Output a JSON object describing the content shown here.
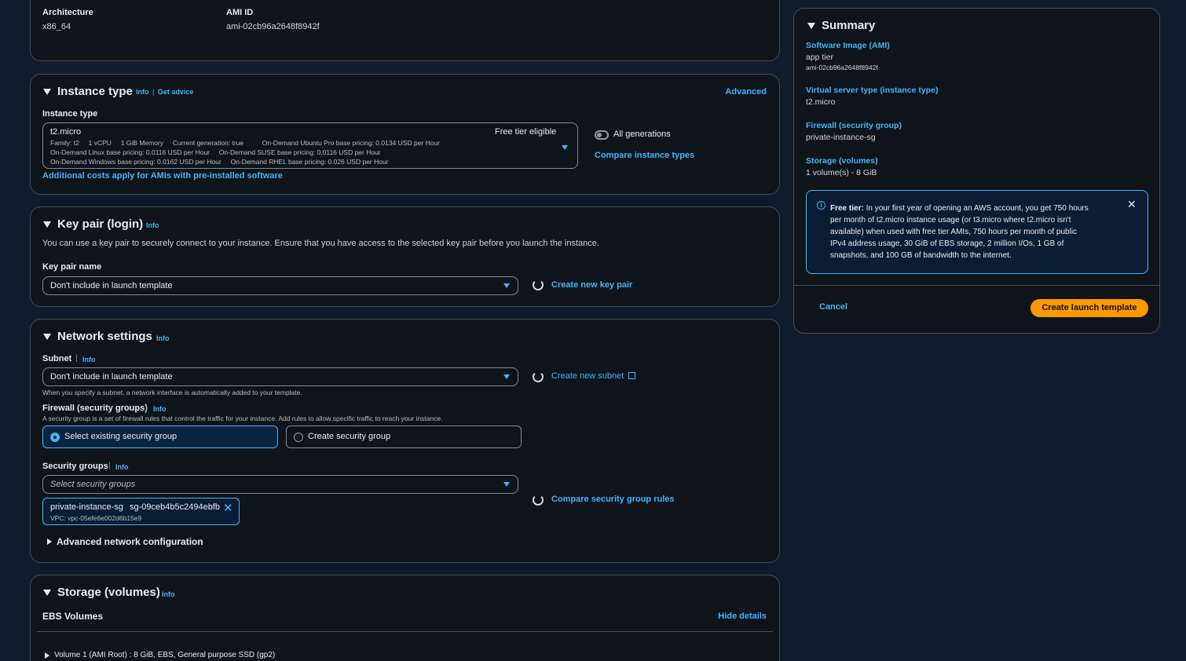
{
  "ami_details": {
    "architecture_label": "Architecture",
    "architecture_value": "x86_64",
    "ami_id_label": "AMI ID",
    "ami_id_value": "ami-02cb96a2648f8942f"
  },
  "instance_type": {
    "title": "Instance type",
    "info": "Info",
    "get_advice": "Get advice",
    "advanced": "Advanced",
    "field_label": "Instance type",
    "selected": "t2.micro",
    "free_tier": "Free tier eligible",
    "line1": "Family: t2     1 vCPU     1 GiB Memory     Current generation: true          On-Demand Ubuntu Pro base pricing: 0.0134 USD per Hour",
    "line2": "On-Demand Linux base pricing: 0.0116 USD per Hour     On-Demand SUSE base pricing: 0.0116 USD per Hour",
    "line3": "On-Demand Windows base pricing: 0.0162 USD per Hour     On-Demand RHEL base pricing: 0.026 USD per Hour",
    "all_generations": "All generations",
    "compare": "Compare instance types",
    "additional_costs": "Additional costs apply for AMIs with pre-installed software"
  },
  "key_pair": {
    "title": "Key pair (login)",
    "info": "Info",
    "description": "You can use a key pair to securely connect to your instance. Ensure that you have access to the selected key pair before you launch the instance.",
    "field_label": "Key pair name",
    "selected": "Don't include in launch template",
    "create_new": "Create new key pair"
  },
  "network": {
    "title": "Network settings",
    "info": "Info",
    "subnet_label": "Subnet",
    "subnet_info": "Info",
    "subnet_selected": "Don't include in launch template",
    "create_subnet": "Create new subnet",
    "subnet_hint": "When you specify a subnet, a network interface is automatically added to your template.",
    "firewall_label": "Firewall (security groups)",
    "firewall_info": "Info",
    "firewall_hint": "A security group is a set of firewall rules that control the traffic for your instance. Add rules to allow specific traffic to reach your instance.",
    "option_existing": "Select existing security group",
    "option_create": "Create security group",
    "sg_label": "Security groups",
    "sg_info": "Info",
    "sg_placeholder": "Select security groups",
    "token_name": "private-instance-sg",
    "token_id": "sg-09ceb4b5c2494ebfb",
    "token_vpc": "VPC: vpc-05efe6e002d6b15e9",
    "compare_rules": "Compare security group rules",
    "advanced_config": "Advanced network configuration"
  },
  "storage": {
    "title": "Storage (volumes)",
    "info": "Info",
    "ebs_label": "EBS Volumes",
    "hide_details": "Hide details",
    "volume1": "Volume 1 (AMI Root) : 8 GiB, EBS, General purpose SSD (gp2)"
  },
  "summary": {
    "title": "Summary",
    "ami_label": "Software Image (AMI)",
    "ami_value": "app tier",
    "ami_id": "ami-02cb96a2648f8942f",
    "type_label": "Virtual server type (instance type)",
    "type_value": "t2.micro",
    "firewall_label": "Firewall (security group)",
    "firewall_value": "private-instance-sg",
    "storage_label": "Storage (volumes)",
    "storage_value": "1 volume(s) - 8 GiB",
    "free_tier_bold": "Free tier:",
    "free_tier_line1": " In your first year of opening an AWS account, you get 750 hours",
    "free_tier_line2": "per month of t2.micro instance usage (or t3.micro where t2.micro isn't",
    "free_tier_line3": "available) when used with free tier AMIs, 750 hours per month of public",
    "free_tier_line4": "IPv4 address usage, 30 GiB of EBS storage, 2 million I/Os, 1 GB of",
    "free_tier_line5": "snapshots, and 100 GB of bandwidth to the internet.",
    "cancel": "Cancel",
    "create": "Create launch template"
  },
  "colors": {
    "accent": "#42b4ff",
    "primary_button": "#ff9900",
    "panel_bg": "#0f141a",
    "page_bg": "#0f1b2a"
  }
}
